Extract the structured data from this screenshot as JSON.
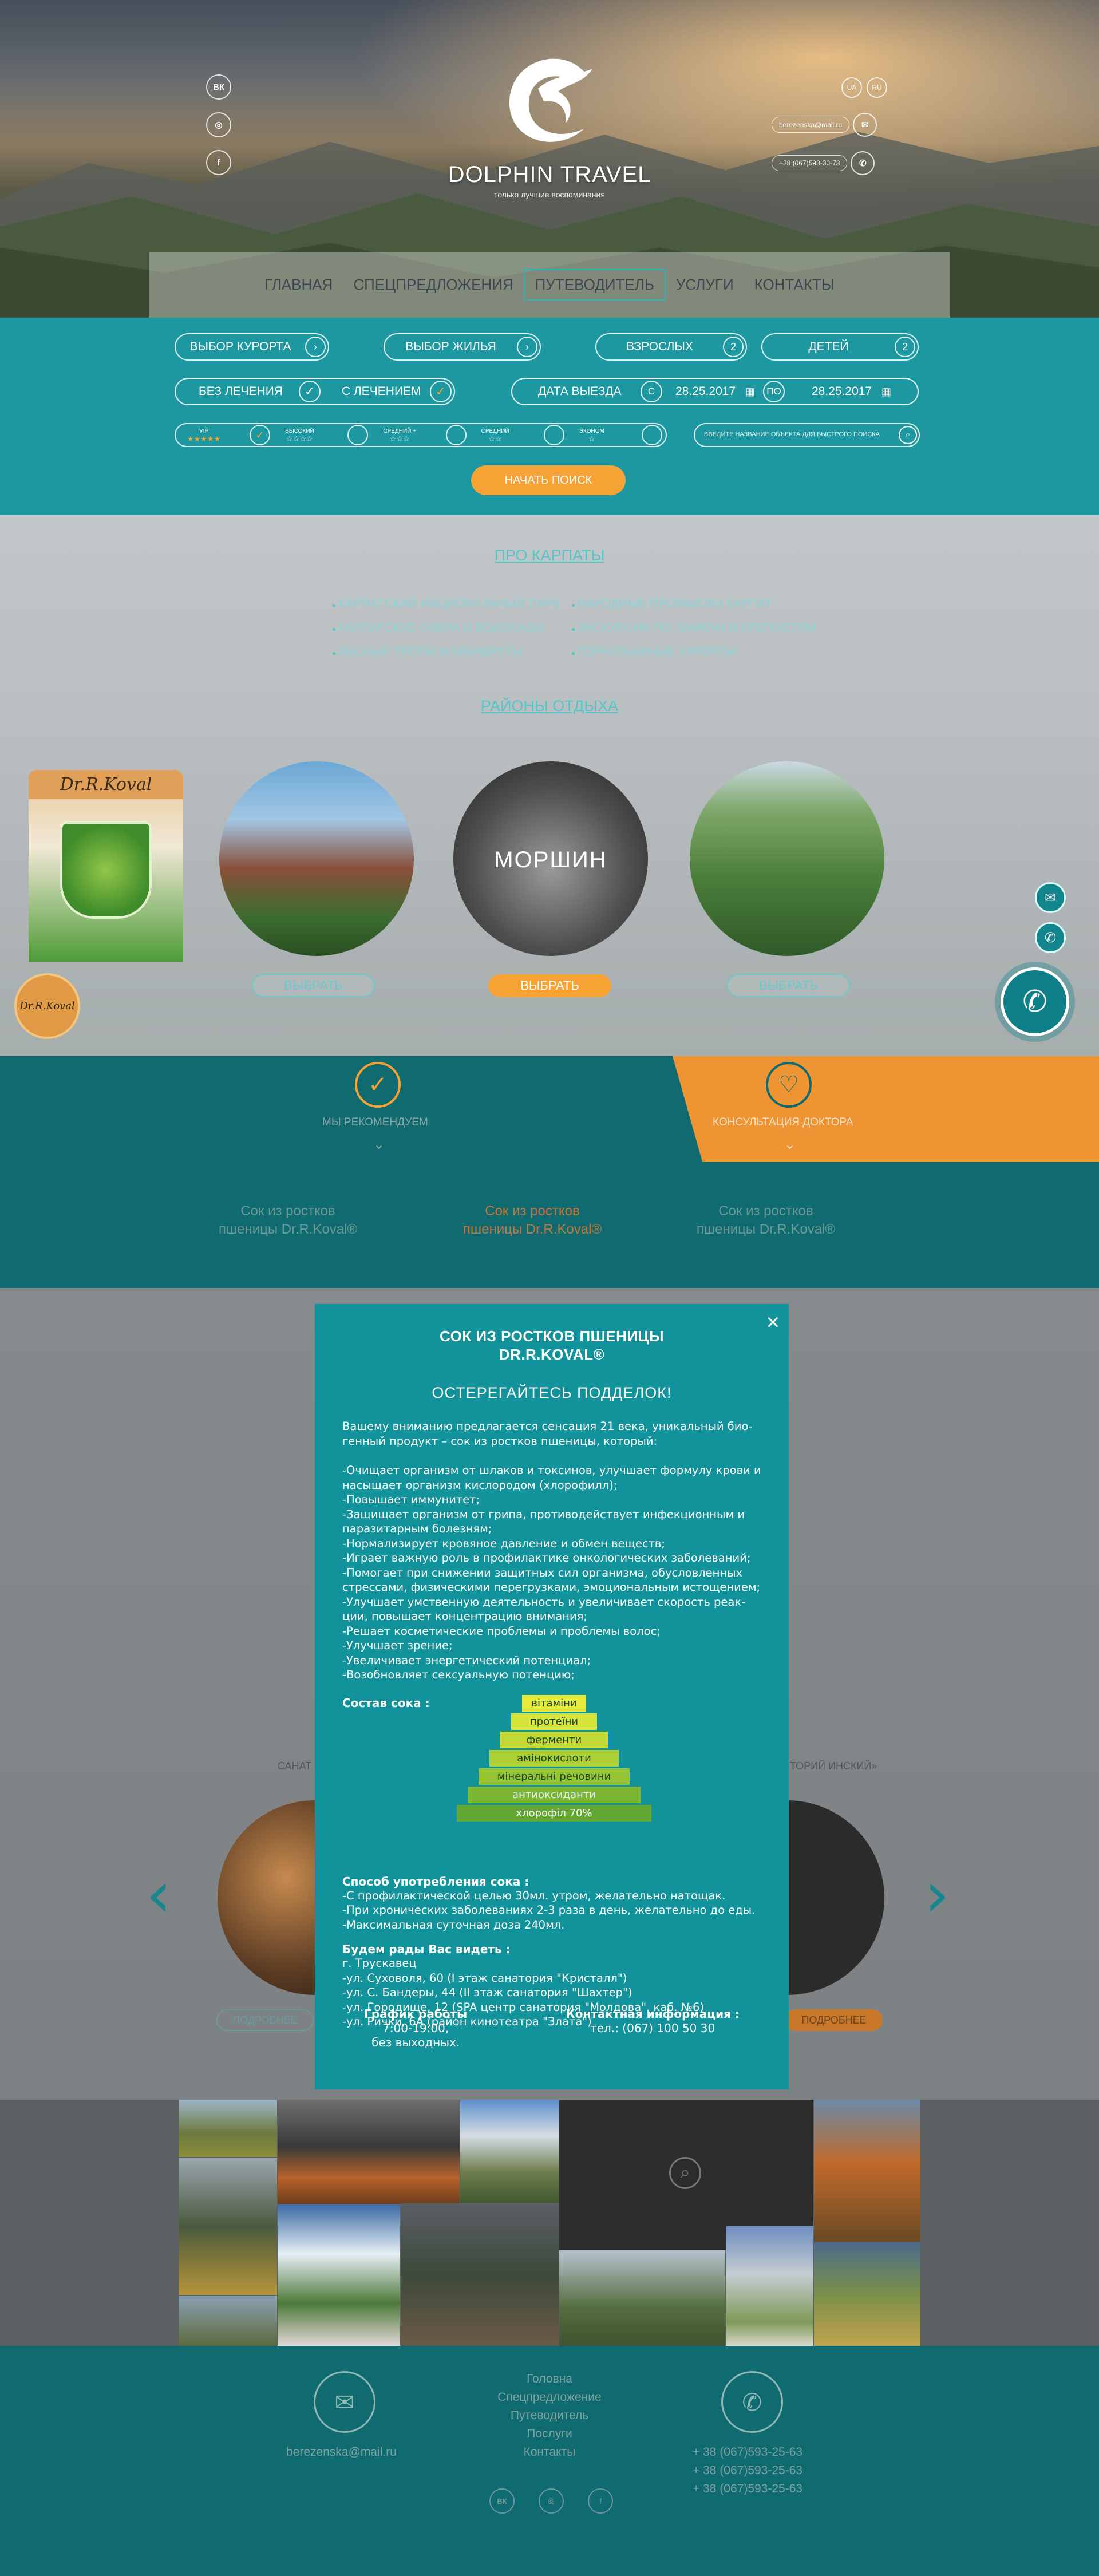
{
  "brand": {
    "name": "DOLPHIN TRAVEL",
    "tagline": "только лучшие воспоминания"
  },
  "header": {
    "social": [
      "ВК",
      "◎",
      "f"
    ],
    "langs": [
      "UA",
      "RU"
    ],
    "email": "berezenska@mail.ru",
    "phone": "+38 (067)593-30-73"
  },
  "nav": [
    "ГЛАВНАЯ",
    "СПЕЦПРЕДЛОЖЕНИЯ",
    "ПУТЕВОДИТЕЛЬ",
    "УСЛУГИ",
    "КОНТАКТЫ"
  ],
  "search": {
    "resort": "ВЫБОР КУРОРТА",
    "housing": "ВЫБОР ЖИЛЬЯ",
    "adults_label": "ВЗРОСЛЫХ",
    "adults": "2",
    "kids_label": "ДЕТЕЙ",
    "kids": "2",
    "no_treatment": "БЕЗ ЛЕЧЕНИЯ",
    "treatment": "С ЛЕЧЕНИЕМ",
    "departure": "ДАТА ВЫЕЗДА",
    "from": "С",
    "from_date": "28.25.2017",
    "to": "ПО",
    "to_date": "28.25.2017",
    "classes": [
      {
        "label": "VIP",
        "stars": "★★★★★"
      },
      {
        "label": "ВЫСОКИЙ",
        "stars": "☆☆☆☆"
      },
      {
        "label": "СРЕДНИЙ +",
        "stars": "☆☆☆"
      },
      {
        "label": "СРЕДНИЙ",
        "stars": "☆☆"
      },
      {
        "label": "ЭКОНОМ",
        "stars": "☆"
      }
    ],
    "quick_placeholder": "ВВЕДИТЕ НАЗВАНИЕ ОБЪЕКТА ДЛЯ БЫСТРОГО ПОИСКА",
    "submit": "НАЧАТЬ ПОИСК"
  },
  "about": {
    "title": "ПРО КАРПАТЫ",
    "list_left": [
      "КАРПАТСКИЙ НАЦИОНАЛЬНЫЙ ПАРК",
      "КАРПАТСКИЕ ОЗЕРА И ВОДОПАДЫ",
      "ЛЕСНЫЕ ТРОПЫ И МАРШРУТЫ"
    ],
    "list_right": [
      "НАРОДНЫЕ ПРОМЫСЛЫ КАРПАТ",
      "ЭКСКУРСИИ ПО ЗАМКАМ И КРЕПОСТЯМ",
      "ГОРНОЛЫЖНЫЕ КУРОРТЫ"
    ]
  },
  "regions": {
    "title": "РАЙОНЫ ОТДЫХА",
    "center_name": "МОРШИН",
    "choose": "ВЫБРАТЬ"
  },
  "ad": {
    "brand": "Dr.R.Koval",
    "badge": "Dr.R.Koval"
  },
  "band": {
    "recommend": "МЫ РЕКОМЕНДУЕМ",
    "doctor": "КОНСУЛЬТАЦИЯ ДОКТОРА",
    "items": [
      "Сок из ростков пшеницы Dr.R.Koval®",
      "Сок из ростков пшеницы Dr.R.Koval®",
      "Сок из ростков пшеницы Dr.R.Koval®"
    ]
  },
  "sanatoriums": {
    "more": "ПОДРОБНЕЕ",
    "left_title": "САНАТ «БОГ",
    "right_title": "ТОРИЙ ИНСКИЙ»"
  },
  "modal": {
    "title1": "СОК ИЗ РОСТКОВ ПШЕНИЦЫ",
    "title2": "DR.R.KOVAL®",
    "warn": "ОСТЕРЕГАЙТЕСЬ ПОДДЕЛОК!",
    "intro": "Вашему вниманию предлагается сенсация 21 века, уникальный био-\nгенный продукт – сок из ростков пшеницы, который:",
    "benefits": "-Очищает организм от шлаков и токсинов, улучшает формулу крови и\nнасыщает организм кислородом (хлорофилл);\n-Повышает иммунитет;\n-Защищает организм от грипа, противодействует инфекционным и\nпаразитарным болезням;\n-Нормализирует кровяное давление и обмен веществ;\n-Играет важную роль в профилактике онкологических заболеваний;\n-Помогает при снижении защитных сил организма, обусловленных\nстрессами, физическими перегрузками, эмоциональным истощением;\n-Улучшает умственную деятельность и увеличивает скорость реак-\nции, повышает концентрацию внимания;\n-Решает косметические проблемы и проблемы волос;\n-Улучшает зрение;\n-Увеличивает энергетический потенциал;\n-Возобновляет сексуальную потенцию;",
    "composition_h": "Состав сока :",
    "composition": [
      "вітаміни",
      "протеїни",
      "ферменти",
      "амінокислоти",
      "мінеральні речовини",
      "антиоксиданти",
      "хлорофіл 70%"
    ],
    "usage_h": "Способ употребления сока :",
    "usage": "-С профилактической целью 30мл. утром, желательно натощак.\n-При хронических заболеваниях 2-3 раза в день, желательно до еды.\n-Максимальная суточная доза 240мл.",
    "visit_h": "Будем рады Вас видеть :",
    "visit": "г. Трускавец\n-ул. Суховоля, 60 (I этаж санатория \"Кристалл\")\n-ул. С. Бандеры, 44 (II этаж санатория \"Шахтер\")\n-ул. Городище, 12 (SPA центр санатория \"Молдова\", каб. №6)\n-ул. Рички, 6А (район кинотеатра \"Злата\")",
    "hours_h": "График работы",
    "hours": "7:00-19:00,\nбез выходных.",
    "contact_h": "Контактная информация :",
    "contact": "тел.: (067) 100 50 30",
    "close": "×"
  },
  "footer": {
    "email": "berezenska@mail.ru",
    "links": [
      "Головна",
      "Спецпредложение",
      "Путеводитель",
      "Послуги",
      "Контакты"
    ],
    "phones": [
      "+ 38 (067)593-25-63",
      "+ 38 (067)593-25-63",
      "+ 38 (067)593-25-63"
    ],
    "social": [
      "ВК",
      "◎",
      "f"
    ]
  },
  "colors": {
    "teal": "#1e98a0",
    "teal_dark": "#0f6b70",
    "orange": "#f7a234",
    "modal": "#12939b"
  }
}
